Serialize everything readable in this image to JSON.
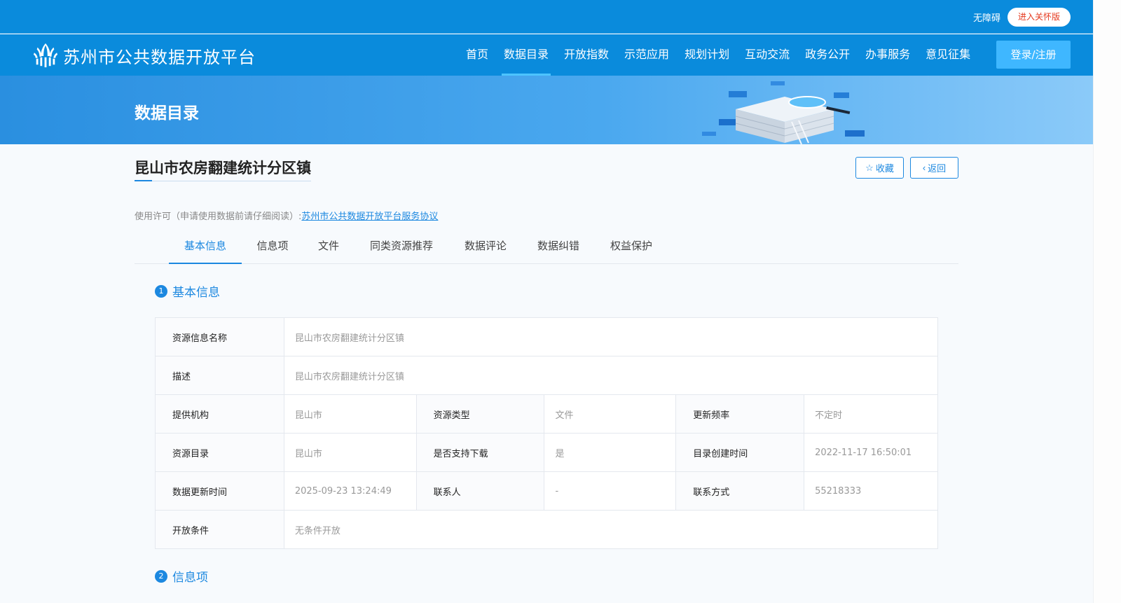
{
  "topbar": {
    "accessibility": "无障碍",
    "care_mode": "进入关怀版"
  },
  "header": {
    "logo_text": "苏州市公共数据开放平台",
    "nav": [
      "首页",
      "数据目录",
      "开放指数",
      "示范应用",
      "规划计划",
      "互动交流",
      "政务公开",
      "办事服务",
      "意见征集"
    ],
    "active_nav": "数据目录",
    "login": "登录/注册"
  },
  "banner": {
    "title": "数据目录"
  },
  "resource": {
    "title": "昆山市农房翻建统计分区镇",
    "favorite": "收藏",
    "back": "返回",
    "license_prefix": "使用许可（申请使用数据前请仔细阅读）:",
    "license_link": "苏州市公共数据开放平台服务协议"
  },
  "tabs": [
    "基本信息",
    "信息项",
    "文件",
    "同类资源推荐",
    "数据评论",
    "数据纠错",
    "权益保护"
  ],
  "active_tab": "基本信息",
  "sections": [
    {
      "num": "1",
      "label": "基本信息"
    },
    {
      "num": "2",
      "label": "信息项"
    }
  ],
  "basic_info": {
    "name_label": "资源信息名称",
    "name_value": "昆山市农房翻建统计分区镇",
    "desc_label": "描述",
    "desc_value": "昆山市农房翻建统计分区镇",
    "org_label": "提供机构",
    "org_value": "昆山市",
    "type_label": "资源类型",
    "type_value": "文件",
    "freq_label": "更新频率",
    "freq_value": "不定时",
    "catalog_label": "资源目录",
    "catalog_value": "昆山市",
    "download_label": "是否支持下载",
    "download_value": "是",
    "created_label": "目录创建时间",
    "created_value": "2022-11-17 16:50:01",
    "updated_label": "数据更新时间",
    "updated_value": "2025-09-23 13:24:49",
    "contact_label": "联系人",
    "contact_value": "-",
    "phone_label": "联系方式",
    "phone_value": "55218333",
    "condition_label": "开放条件",
    "condition_value": "无条件开放"
  },
  "colors": {
    "primary": "#0a8bdc",
    "accent": "#1c88e0",
    "care_text": "#e5391e"
  }
}
